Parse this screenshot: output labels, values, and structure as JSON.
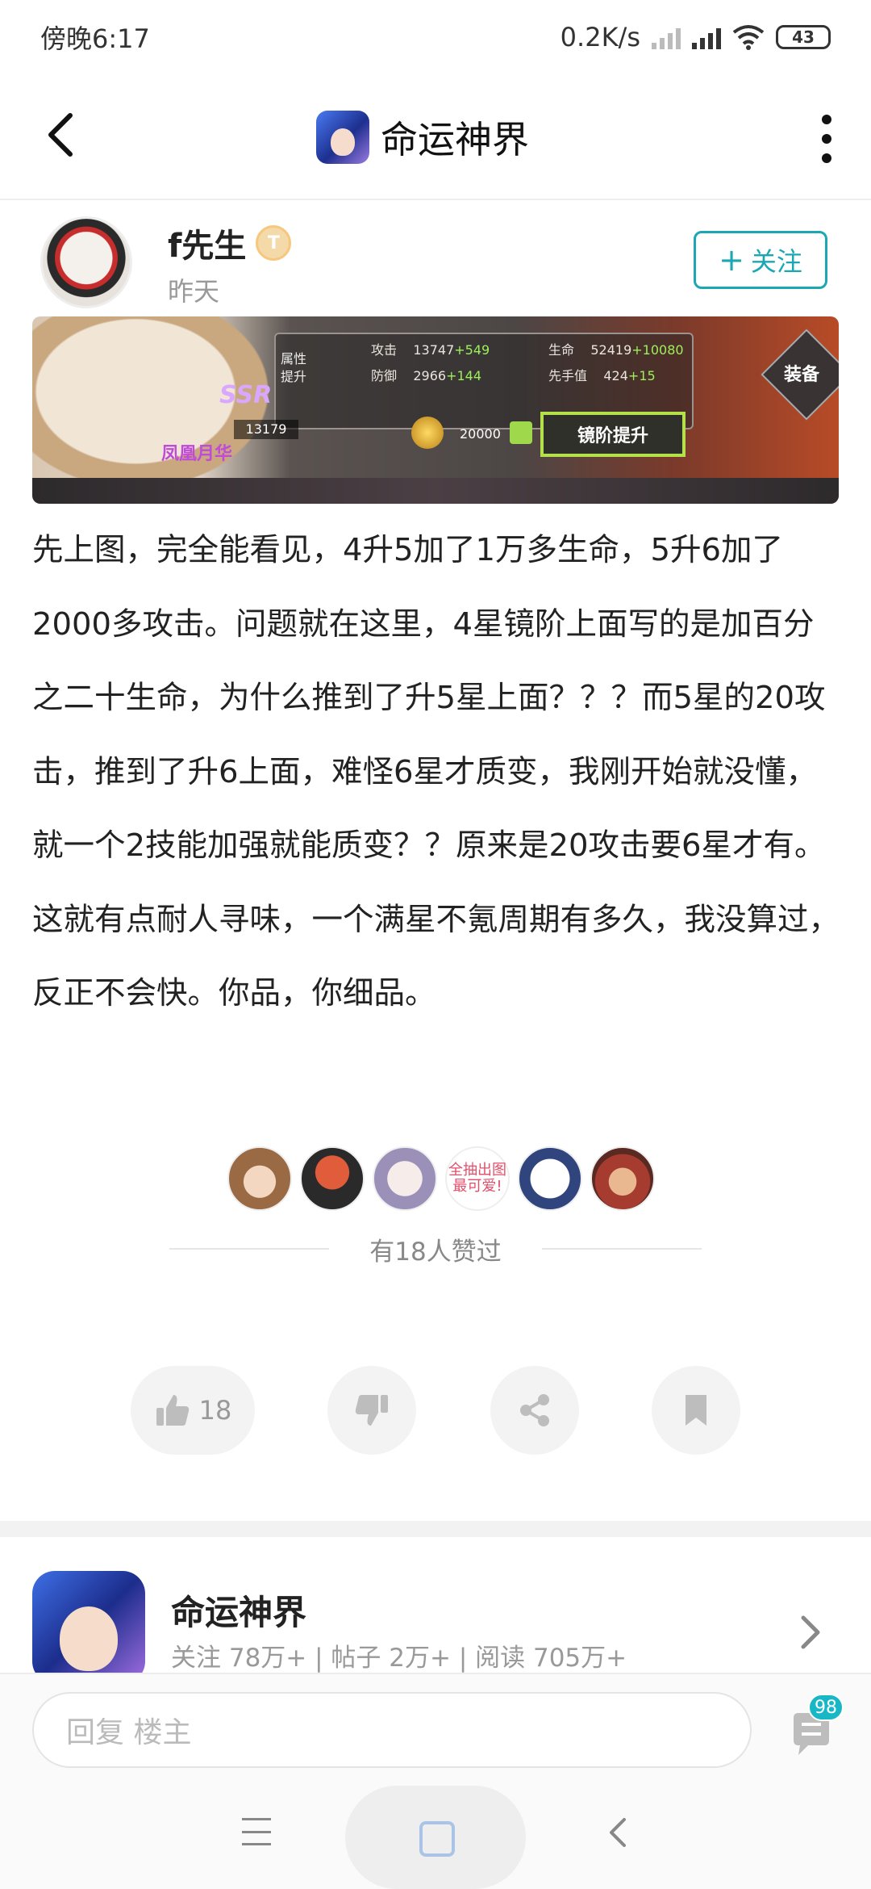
{
  "status_bar": {
    "time": "傍晚6:17",
    "net_speed": "0.2K/s",
    "battery": "43"
  },
  "header": {
    "title": "命运神界"
  },
  "post": {
    "author": "f先生",
    "badge": "T",
    "time": "昨天",
    "follow_label": "关注",
    "image": {
      "attr_label_1": "属性",
      "attr_label_2": "提升",
      "attack_label": "攻击",
      "attack_value": "13747",
      "attack_add": "+549",
      "hp_label": "生命",
      "hp_value": "52419",
      "hp_add": "+10080",
      "def_label": "防御",
      "def_value": "2966",
      "def_add": "+144",
      "speed_label": "先手值",
      "speed_value": "424",
      "speed_add": "+15",
      "rarity": "SSR",
      "power": "13179",
      "hero_name": "凤凰月华",
      "cost": "20000",
      "upgrade_button": "镜阶提升",
      "equip_label": "装备"
    },
    "paragraph": "先上图，完全能看见，4升5加了1万多生命，5升6加了2000多攻击。问题就在这里，4星镜阶上面写的是加百分之二十生命，为什么推到了升5星上面？？？而5星的20攻击，推到了升6上面，难怪6星才质变，我刚开始就没懂，就一个2技能加强就能质变？？原来是20攻击要6星才有。这就有点耐人寻味，一个满星不氪周期有多久，我没算过，反正不会快。你品，你细品。",
    "likers_sticker_text": "全抽出图最可爱!",
    "likes_text": "有18人赞过",
    "like_count": "18"
  },
  "forum": {
    "name": "命运神界",
    "stats": "关注 78万+ | 帖子 2万+ | 阅读 705万+"
  },
  "reply": {
    "placeholder": "回复  楼主",
    "comment_count": "98"
  }
}
